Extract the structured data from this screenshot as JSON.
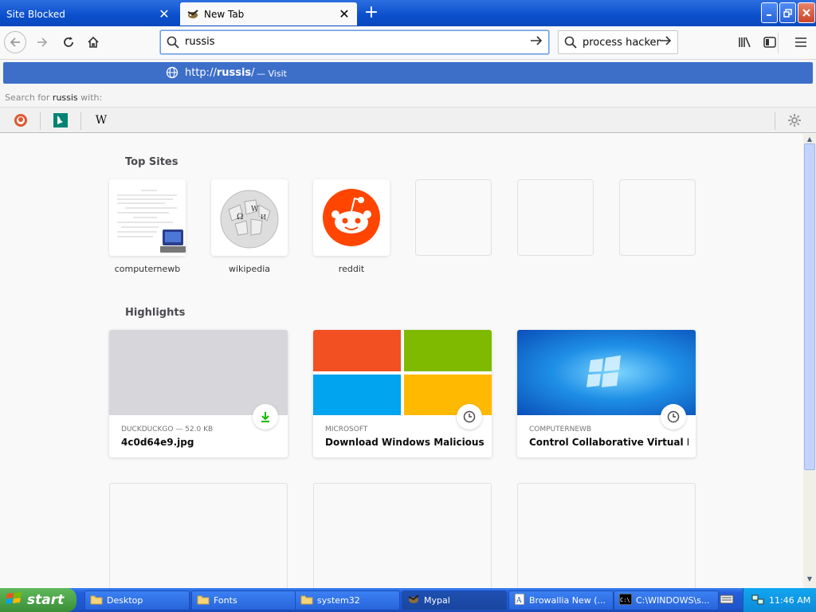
{
  "tabs": [
    {
      "label": "Site Blocked",
      "active": false
    },
    {
      "label": "New Tab",
      "active": true
    }
  ],
  "navbar": {
    "url_value": "russis",
    "search_engine_text": "process hacker"
  },
  "popup": {
    "suggest_url": "http://russis/",
    "suggest_action": "— Visit",
    "search_for_prefix": "Search for",
    "search_for_query": "russis",
    "search_for_suffix": "with:",
    "engines": [
      "duckduckgo-icon",
      "bing-icon",
      "wikipedia-icon"
    ]
  },
  "top_sites": {
    "title": "Top Sites",
    "items": [
      {
        "label": "computernewb"
      },
      {
        "label": "wikipedia"
      },
      {
        "label": "reddit"
      },
      {
        "label": ""
      },
      {
        "label": ""
      },
      {
        "label": ""
      }
    ]
  },
  "highlights": {
    "title": "Highlights",
    "items": [
      {
        "meta": "DUCKDUCKGO — 52.0 KB",
        "title": "4c0d64e9.jpg",
        "badge": "download-icon"
      },
      {
        "meta": "MICROSOFT",
        "title": "Download Windows Malicious So...",
        "badge": "clock-icon"
      },
      {
        "meta": "COMPUTERNEWB",
        "title": "Control Collaborative Virtual Ma...",
        "badge": "clock-icon"
      }
    ]
  },
  "taskbar": {
    "start_label": "start",
    "tasks": [
      {
        "label": "Desktop"
      },
      {
        "label": "Fonts"
      },
      {
        "label": "system32"
      },
      {
        "label": "Mypal"
      },
      {
        "label": "Browallia New (..."
      },
      {
        "label": "C:\\WINDOWS\\s..."
      }
    ],
    "clock": "11:46 AM"
  },
  "colors": {
    "accent": "#3d6fc9",
    "download_green": "#12bc00",
    "reddit_orange": "#ff4500"
  }
}
